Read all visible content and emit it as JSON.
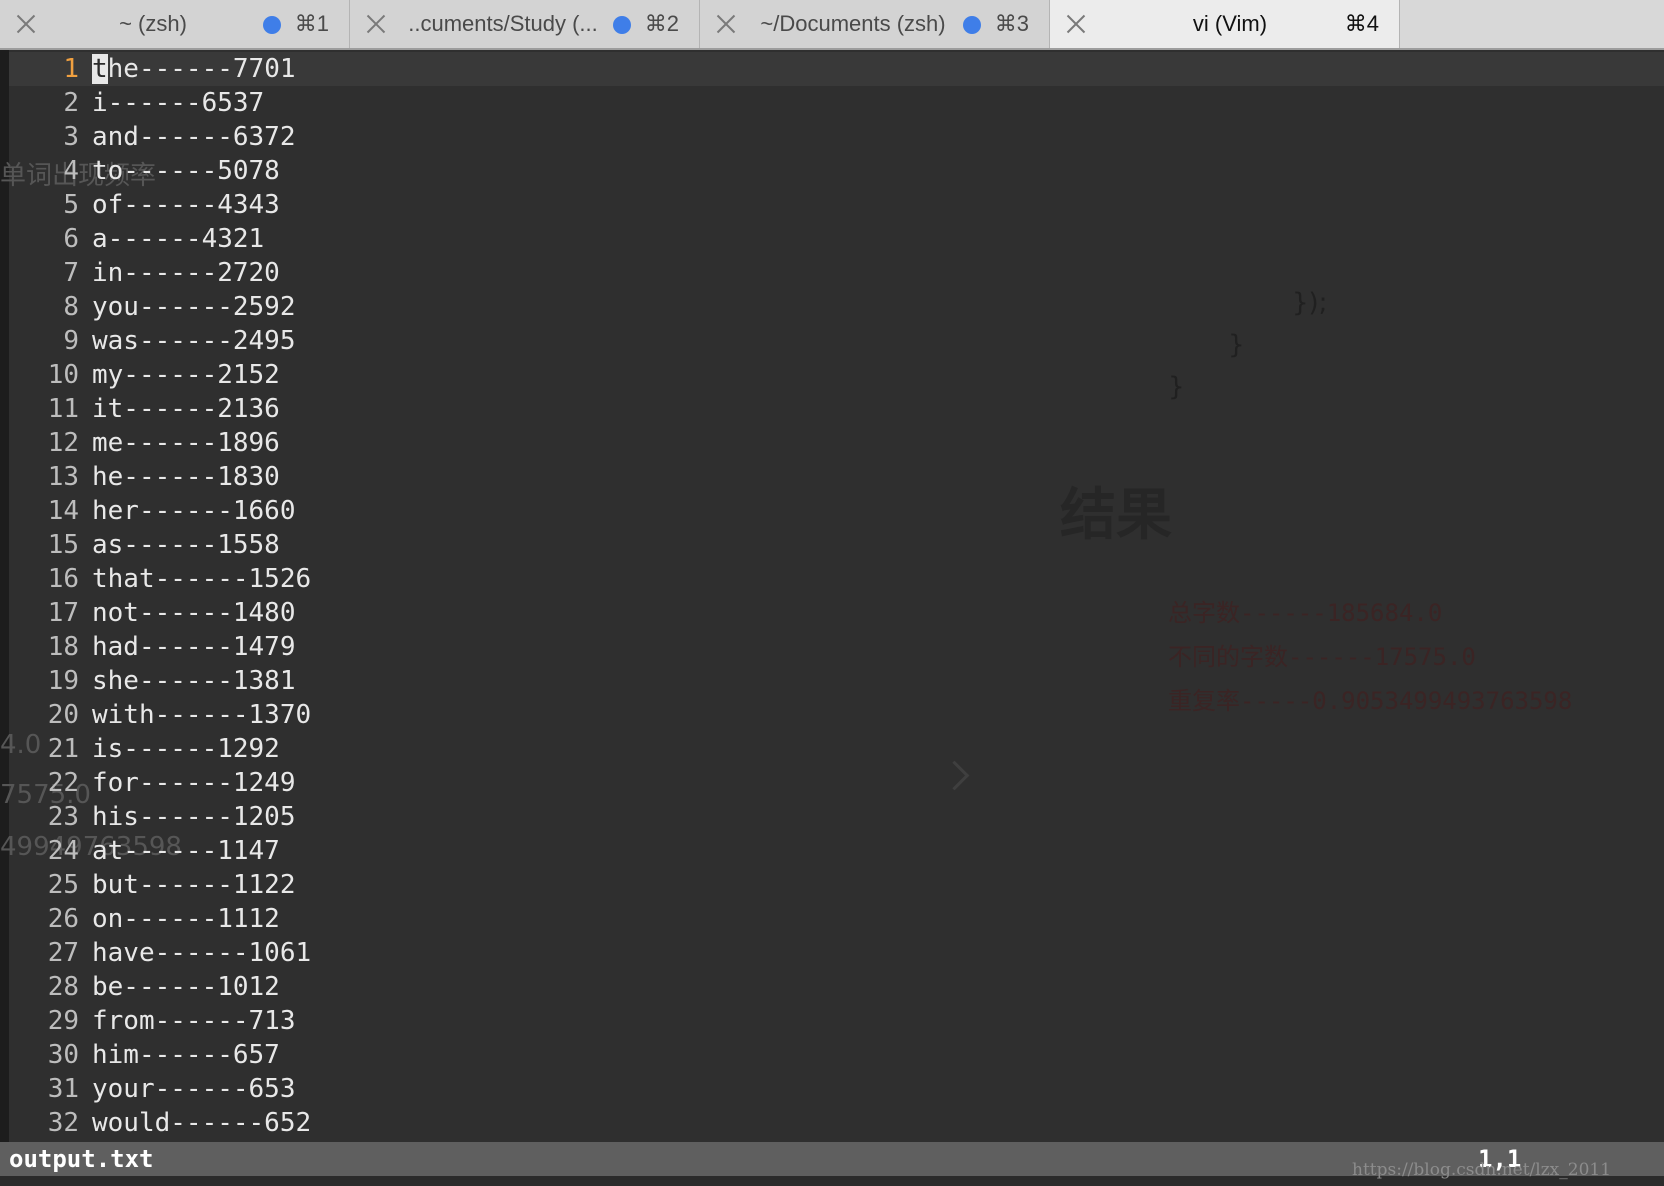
{
  "tabs": [
    {
      "title": "~ (zsh)",
      "shortcut": "⌘1",
      "active": false,
      "has_dot": true
    },
    {
      "title": "..cuments/Study (...",
      "shortcut": "⌘2",
      "active": false,
      "has_dot": true
    },
    {
      "title": "~/Documents (zsh)",
      "shortcut": "⌘3",
      "active": false,
      "has_dot": true
    },
    {
      "title": "vi (Vim)",
      "shortcut": "⌘4",
      "active": true,
      "has_dot": false
    }
  ],
  "editor": {
    "lines": [
      "the------7701",
      "i------6537",
      "and------6372",
      "to------5078",
      "of------4343",
      "a------4321",
      "in------2720",
      "you------2592",
      "was------2495",
      "my------2152",
      "it------2136",
      "me------1896",
      "he------1830",
      "her------1660",
      "as------1558",
      "that------1526",
      "not------1480",
      "had------1479",
      "she------1381",
      "with------1370",
      "is------1292",
      "for------1249",
      "his------1205",
      "at------1147",
      "but------1122",
      "on------1112",
      "have------1061",
      "be------1012",
      "from------713",
      "him------657",
      "your------653",
      "would------652"
    ],
    "cursor": {
      "line": 1,
      "col": 1
    }
  },
  "background_ghost": {
    "heading": "结果",
    "left_label": "单词出现频率",
    "results": [
      "总字数------185684.0",
      "不同的字数------17575.0",
      "重复率-----0.9053499493763598"
    ],
    "braces": [
      "});",
      "}",
      "}"
    ],
    "left_fragments": [
      "4.0",
      "7575.0",
      "49949763598"
    ]
  },
  "status": {
    "filename": "output.txt",
    "position": "1,1"
  },
  "watermark": "https://blog.csdn.net/lzx_2011",
  "colors": {
    "dot": "#3f7ee8",
    "current_line_number": "#f0a040"
  }
}
